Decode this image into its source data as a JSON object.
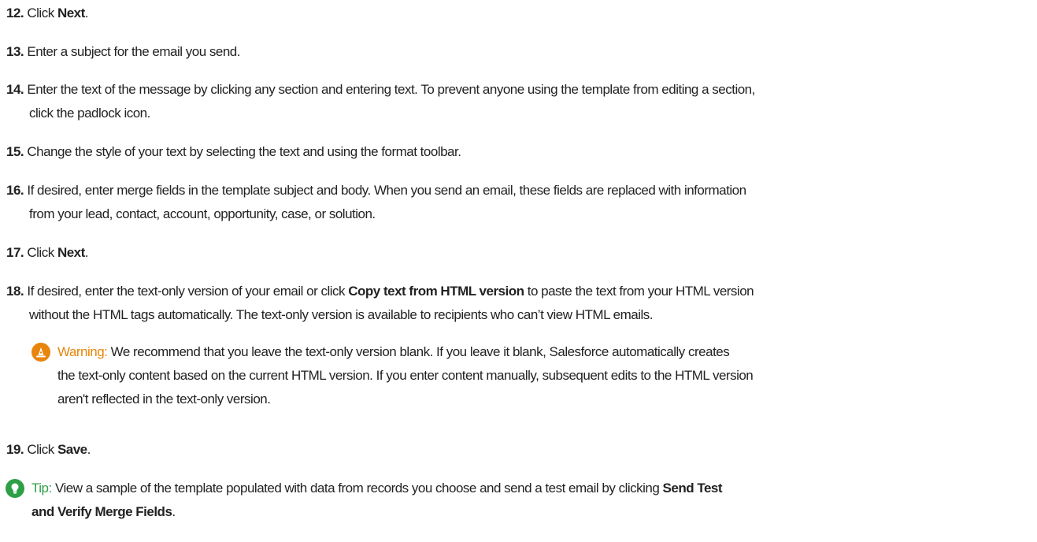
{
  "steps": [
    {
      "num": "12.",
      "pre": "Click ",
      "bold": "Next",
      "post": "."
    },
    {
      "num": "13.",
      "text": "Enter a subject for the email you send."
    },
    {
      "num": "14.",
      "line1": "Enter the text of the message by clicking any section and entering text. To prevent anyone using the template from editing a section,",
      "line2": "click the padlock icon."
    },
    {
      "num": "15.",
      "text": "Change the style of your text by selecting the text and using the format toolbar."
    },
    {
      "num": "16.",
      "line1": "If desired, enter merge fields in the template subject and body. When you send an email, these fields are replaced with information",
      "line2": "from your lead, contact, account, opportunity, case, or solution."
    },
    {
      "num": "17.",
      "pre": "Click ",
      "bold": "Next",
      "post": "."
    },
    {
      "num": "18.",
      "pre": "If desired, enter the text-only version of your email or click ",
      "bold": "Copy text from HTML version",
      "post": " to paste the text from your HTML version",
      "line2": "without the HTML tags automatically. The text-only version is available to recipients who can’t view HTML emails."
    },
    {
      "num": "19.",
      "pre": "Click ",
      "bold": "Save",
      "post": "."
    }
  ],
  "warning": {
    "label": "Warning:",
    "line1": "We recommend that you leave the text-only version blank. If you leave it blank, Salesforce automatically creates",
    "line2": "the text-only content based on the current HTML version. If you enter content manually, subsequent edits to the HTML version",
    "line3": "aren't reflected in the text-only version.",
    "icon": "warning-icon",
    "color": "#e8850c"
  },
  "tip": {
    "label": "Tip:",
    "pre": "View a sample of the template populated with data from records you choose and send a test email by clicking ",
    "bold1": "Send Test",
    "bold2": "and Verify Merge Fields",
    "post": ".",
    "icon": "lightbulb-icon",
    "color": "#2e9f46"
  }
}
